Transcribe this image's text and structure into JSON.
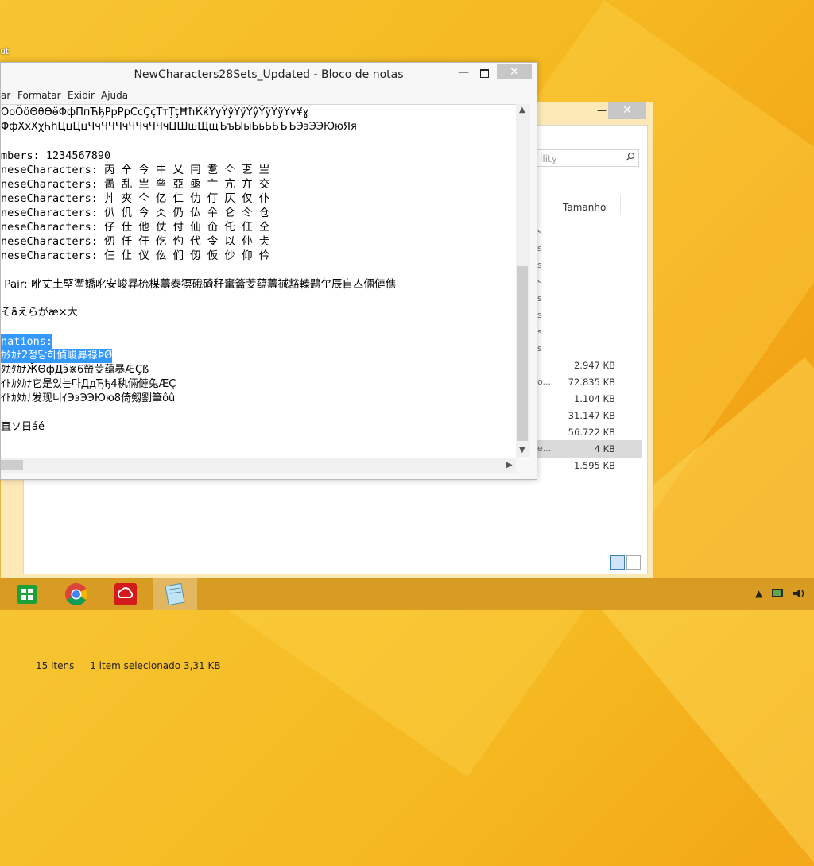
{
  "desktop": {
    "partial_label": "ut"
  },
  "explorer": {
    "search_placeholder": "ility",
    "column_size": "Tamanho",
    "row_fragments": [
      "s",
      "s",
      "s",
      "s",
      "s",
      "s",
      "s",
      "s",
      "o...",
      "",
      "",
      "",
      "e...",
      ""
    ],
    "sizes": [
      "",
      "",
      "",
      "",
      "",
      "",
      "",
      "",
      "2.947 KB",
      "72.835 KB",
      "1.104 KB",
      "31.147 KB",
      "56.722 KB",
      "4 KB",
      "1.595 KB"
    ],
    "status_count": "15 itens",
    "status_selected": "1 item selecionado  3,31 KB"
  },
  "notepad": {
    "title": "NewCharacters28Sets_Updated - Bloco de notas",
    "menu": [
      "ar",
      "Formatar",
      "Exibir",
      "Ajuda"
    ],
    "lines": [
      "OoÖöΘθӨӫΦфПпЋђPpРрCcÇçTтŢţĦħЌќYyŶŷŸÿŶŷŸÿŸÿYγ¥ɣ",
      "ΦфXxXχҺһЦцЦцЧчЧЧЧчЧЧчЧЧчЦШшЩщЪъЫыЬьЬЬЪЪЭэЭЭЮюЯя",
      "",
      "mbers: 1234567890",
      "neseCharacters: 丙 㐃 今 中 乂 冃 乽 亽 乤 亗",
      "neseCharacters: 啚 乱 亗 亝 亞 亟 亠 亢 亣 交",
      "neseCharacters: 丼 夾 亽 亿 仁 仂 仃 仄 仅 仆",
      "neseCharacters: 仈 仉 今 仌 仍 仏 仐 仑 仒 仓",
      "neseCharacters: 仔 仕 他 仗 付 仙 仚 仛 仜 仝",
      "neseCharacters: 仞 仟 仠 仡 仢 代 令 以 仦 仧",
      "neseCharacters: 仨 仩 仪 仫 们 仭 仮 仯 仰 仱",
      "",
      " Pair: 吪丈土堅壍嬌吪安峻昪梳楳薵泰猽硪碕秄竃籥芰蕴薵裓豁轃鶗亇辰自亼倆僆僬",
      "そäえらがæ×大",
      "",
      "nations:",
      "ｶﾀｶﾅ2정당하偵峻昪祿ÞØ",
      "ﾀｶﾀｶﾅӁΘфДӭ⋇6嵤芰蕴暴ÆÇß",
      "ｲﾄｶﾀｶﾅ它是있는다ДдЂђ4秇倆僆兔ÆÇ",
      "ｲﾄｶﾀｶﾅ发现니ｲЭэЭЭЮю8倚剱劉筆ôû",
      "",
      "直ソ日áé"
    ]
  },
  "taskbar": {
    "apps": [
      "start",
      "chrome",
      "creative-cloud",
      "notepad"
    ]
  }
}
